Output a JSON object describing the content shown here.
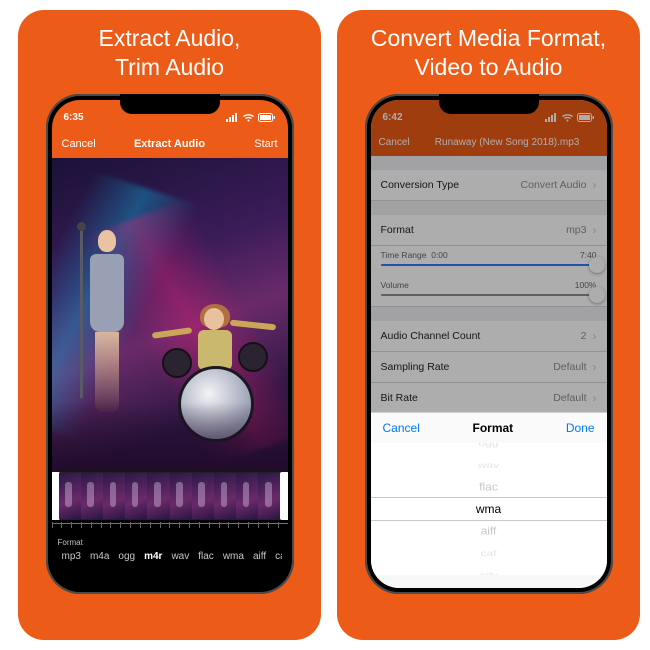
{
  "panels": {
    "a": {
      "title_l1": "Extract Audio,",
      "title_l2": "Trim Audio"
    },
    "b": {
      "title_l1": "Convert Media Format,",
      "title_l2": "Video to Audio"
    }
  },
  "screenA": {
    "status_time": "6:35",
    "nav_left": "Cancel",
    "nav_title": "Extract Audio",
    "nav_right": "Start",
    "format_label": "Format",
    "formats": [
      "mp3",
      "m4a",
      "ogg",
      "m4r",
      "wav",
      "flac",
      "wma",
      "aiff",
      "caf"
    ],
    "selected_format": "m4r"
  },
  "screenB": {
    "status_time": "6:42",
    "nav_left": "Cancel",
    "filename": "Runaway (New Song 2018).mp3",
    "rows": {
      "conv_type": {
        "label": "Conversion Type",
        "value": "Convert Audio"
      },
      "format": {
        "label": "Format",
        "value": "mp3"
      },
      "time_range": {
        "label": "Time Range",
        "start": "0:00",
        "end": "7:40"
      },
      "volume": {
        "label": "Volume",
        "value": "100%"
      },
      "channels": {
        "label": "Audio Channel Count",
        "value": "2"
      },
      "sampling": {
        "label": "Sampling Rate",
        "value": "Default"
      },
      "bitrate": {
        "label": "Bit Rate",
        "value": "Default"
      }
    },
    "picker": {
      "cancel": "Cancel",
      "title": "Format",
      "done": "Done",
      "options": [
        "ogg",
        "wav",
        "flac",
        "wma",
        "aiff",
        "caf",
        "adv"
      ],
      "selected": "wma"
    }
  }
}
